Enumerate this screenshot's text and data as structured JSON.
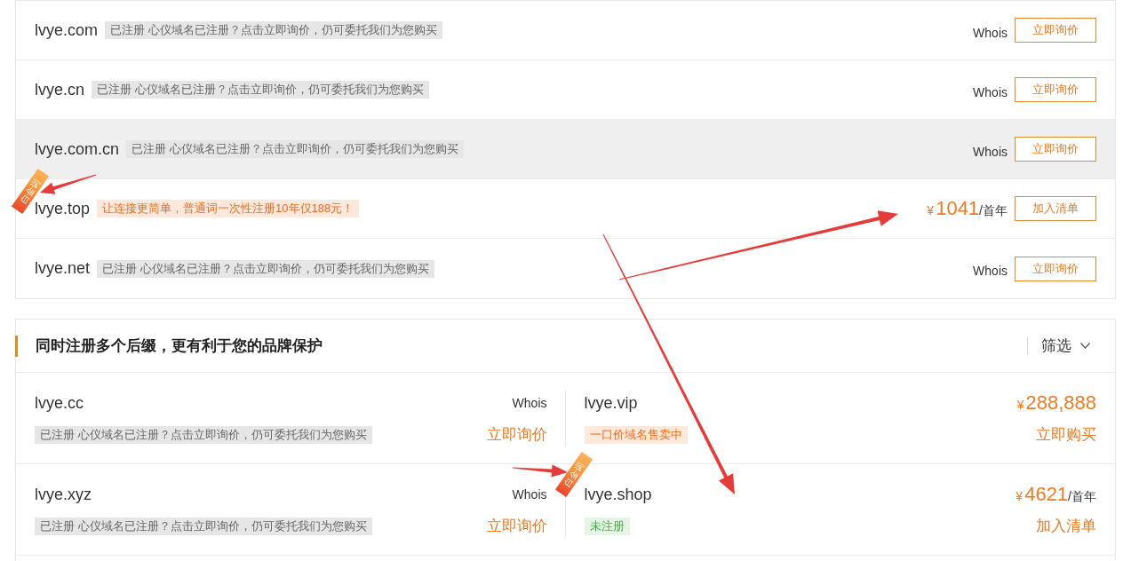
{
  "domain_list": {
    "rows": [
      {
        "domain": "lvye.com",
        "highlighted": false,
        "tag": {
          "kind": "registered",
          "text": "已注册 心仪域名已注册？点击立即询价，仍可委托我们为您购买"
        },
        "whois": "Whois",
        "action": "立即询价"
      },
      {
        "domain": "lvye.cn",
        "highlighted": false,
        "tag": {
          "kind": "registered",
          "text": "已注册 心仪域名已注册？点击立即询价，仍可委托我们为您购买"
        },
        "whois": "Whois",
        "action": "立即询价"
      },
      {
        "domain": "lvye.com.cn",
        "highlighted": true,
        "tag": {
          "kind": "registered",
          "text": "已注册 心仪域名已注册？点击立即询价，仍可委托我们为您购买"
        },
        "whois": "Whois",
        "action": "立即询价"
      },
      {
        "domain": "lvye.top",
        "highlighted": false,
        "ribbon": "白金词",
        "tag": {
          "kind": "promo",
          "text": "让连接更简单，普通词一次性注册10年仅188元！"
        },
        "price": {
          "currency": "¥",
          "amount": "1041",
          "unit": "/首年"
        },
        "action": "加入清单"
      },
      {
        "domain": "lvye.net",
        "highlighted": false,
        "tag": {
          "kind": "registered",
          "text": "已注册 心仪域名已注册？点击立即询价，仍可委托我们为您购买"
        },
        "whois": "Whois",
        "action": "立即询价"
      }
    ]
  },
  "suffix_section": {
    "title": "同时注册多个后缀，更有利于您的品牌保护",
    "filter": "筛选",
    "rows": [
      {
        "cells": [
          {
            "domain": "lvye.cc",
            "whois": "Whois",
            "tag": {
              "kind": "registered",
              "text": "已注册 心仪域名已注册？点击立即询价，仍可委托我们为您购买"
            },
            "action": "立即询价"
          },
          {
            "domain": "lvye.vip",
            "price": {
              "currency": "¥",
              "amount": "288,888"
            },
            "tag": {
              "kind": "promo",
              "text": "一口价域名售卖中"
            },
            "action": "立即购买"
          }
        ]
      },
      {
        "cells": [
          {
            "domain": "lvye.xyz",
            "whois": "Whois",
            "tag": {
              "kind": "registered",
              "text": "已注册 心仪域名已注册？点击立即询价，仍可委托我们为您购买"
            },
            "action": "立即询价"
          },
          {
            "domain": "lvye.shop",
            "ribbon": "白金词",
            "price": {
              "currency": "¥",
              "amount": "4621",
              "unit": "/首年"
            },
            "tag": {
              "kind": "available",
              "text": "未注册"
            },
            "action": "加入清单"
          }
        ]
      }
    ]
  }
}
